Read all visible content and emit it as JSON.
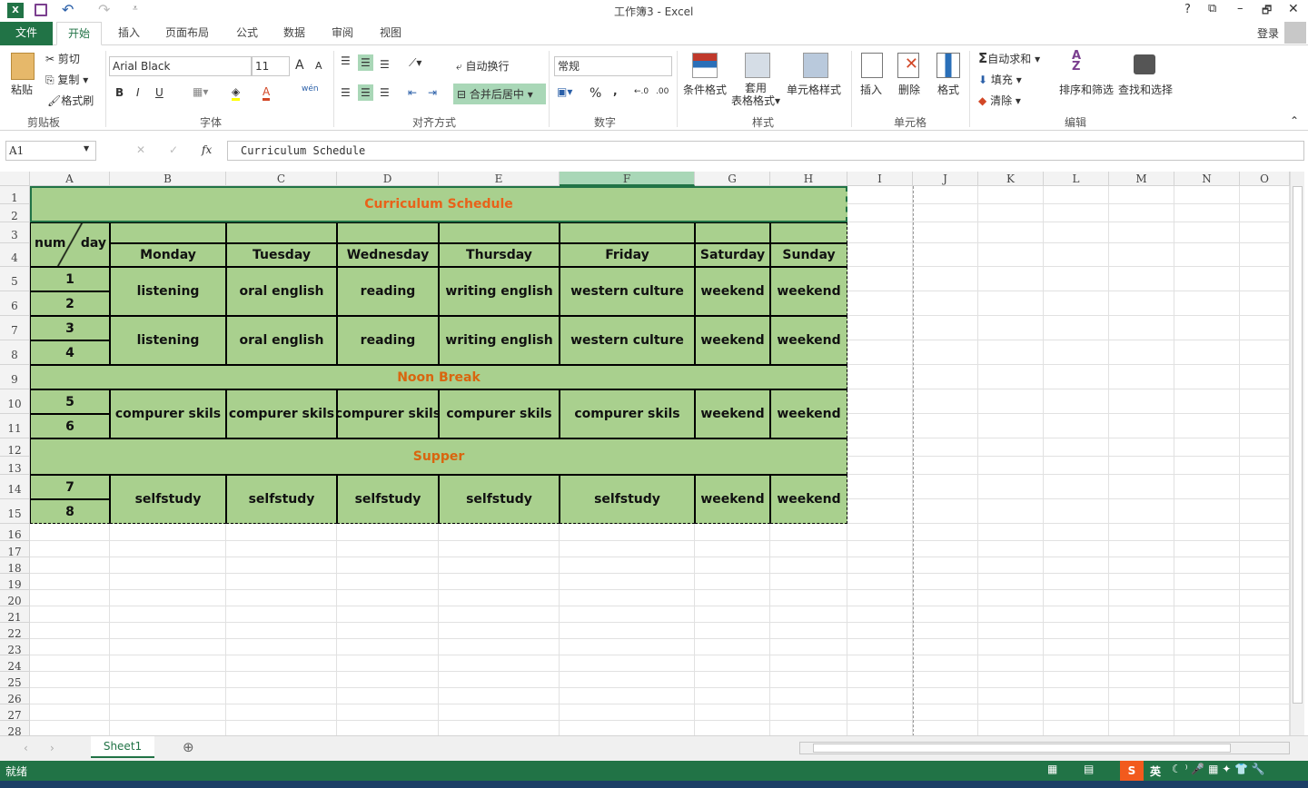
{
  "title_bar": {
    "title": "工作簿3 - Excel",
    "help": "?",
    "ribbon_display": "⧉",
    "minimize": "–",
    "restore": "🗗",
    "close": "✕",
    "login": "登录"
  },
  "tabs": [
    "文件",
    "开始",
    "插入",
    "页面布局",
    "公式",
    "数据",
    "审阅",
    "视图"
  ],
  "active_tab": "开始",
  "ribbon": {
    "clipboard": {
      "paste": "粘贴",
      "cut": "剪切",
      "copy": "复制",
      "format_painter": "格式刷",
      "label": "剪贴板"
    },
    "font": {
      "name": "Arial Black",
      "size": "11",
      "bold": "B",
      "italic": "I",
      "underline": "U",
      "grow": "A",
      "shrink": "A",
      "font_color": "A",
      "phonetic": "wén",
      "label": "字体"
    },
    "alignment": {
      "wrap": "自动换行",
      "merge": "合并后居中",
      "label": "对齐方式"
    },
    "number": {
      "format": "常规",
      "percent": "%",
      "comma": ",",
      "inc_dec": "←.0",
      "dec_dec": ".00",
      "label": "数字"
    },
    "styles": {
      "conditional": "条件格式",
      "table_format_1": "套用",
      "table_format_2": "表格格式",
      "cell_styles": "单元格样式",
      "label": "样式"
    },
    "cells": {
      "insert": "插入",
      "delete": "删除",
      "format": "格式",
      "label": "单元格"
    },
    "editing": {
      "autosum": "自动求和",
      "fill": "填充",
      "clear": "清除",
      "sort": "排序和筛选",
      "find": "查找和选择",
      "label": "编辑"
    }
  },
  "formula_bar": {
    "name_box": "A1",
    "cancel": "✕",
    "enter": "✓",
    "fx": "fx",
    "content": "Curriculum Schedule"
  },
  "columns": [
    "A",
    "B",
    "C",
    "D",
    "E",
    "F",
    "G",
    "H",
    "I",
    "J",
    "K",
    "L",
    "M",
    "N",
    "O"
  ],
  "selected_column": "F",
  "rows": [
    1,
    2,
    3,
    4,
    5,
    6,
    7,
    8,
    9,
    10,
    11,
    12,
    13,
    14,
    15,
    16,
    17,
    18,
    19,
    20,
    21,
    22,
    23,
    24,
    25,
    26,
    27,
    28
  ],
  "fill_color": "#a9d08e",
  "title_color": "#e8621a",
  "cells": [
    {
      "range": "A1:H2",
      "text": "Curriculum Schedule",
      "style": "title"
    },
    {
      "range": "A3:A4",
      "text": "",
      "style": "diag",
      "diag_left": "num",
      "diag_right": "day"
    },
    {
      "range": "B3",
      "text": ""
    },
    {
      "range": "C3",
      "text": ""
    },
    {
      "range": "D3",
      "text": ""
    },
    {
      "range": "E3",
      "text": ""
    },
    {
      "range": "F3",
      "text": ""
    },
    {
      "range": "G3",
      "text": ""
    },
    {
      "range": "H3",
      "text": ""
    },
    {
      "range": "B4",
      "text": "Monday"
    },
    {
      "range": "C4",
      "text": "Tuesday"
    },
    {
      "range": "D4",
      "text": "Wednesday"
    },
    {
      "range": "E4",
      "text": "Thursday"
    },
    {
      "range": "F4",
      "text": "Friday"
    },
    {
      "range": "G4",
      "text": "Saturday"
    },
    {
      "range": "H4",
      "text": "Sunday"
    },
    {
      "range": "A5",
      "text": "1"
    },
    {
      "range": "A6",
      "text": "2"
    },
    {
      "range": "B5:B6",
      "text": "listening"
    },
    {
      "range": "C5:C6",
      "text": "oral english"
    },
    {
      "range": "D5:D6",
      "text": "reading"
    },
    {
      "range": "E5:E6",
      "text": "writing english"
    },
    {
      "range": "F5:F6",
      "text": "western culture"
    },
    {
      "range": "G5:G6",
      "text": "weekend"
    },
    {
      "range": "H5:H6",
      "text": "weekend"
    },
    {
      "range": "A7",
      "text": "3"
    },
    {
      "range": "A8",
      "text": "4"
    },
    {
      "range": "B7:B8",
      "text": "listening"
    },
    {
      "range": "C7:C8",
      "text": "oral english"
    },
    {
      "range": "D7:D8",
      "text": "reading"
    },
    {
      "range": "E7:E8",
      "text": "writing english"
    },
    {
      "range": "F7:F8",
      "text": "western culture"
    },
    {
      "range": "G7:G8",
      "text": "weekend"
    },
    {
      "range": "H7:H8",
      "text": "weekend"
    },
    {
      "range": "A9:H9",
      "text": "Noon Break",
      "style": "band"
    },
    {
      "range": "A10",
      "text": "5"
    },
    {
      "range": "A11",
      "text": "6"
    },
    {
      "range": "B10:B11",
      "text": "compurer skils"
    },
    {
      "range": "C10:C11",
      "text": "compurer skils"
    },
    {
      "range": "D10:D11",
      "text": "compurer skils"
    },
    {
      "range": "E10:E11",
      "text": "compurer skils"
    },
    {
      "range": "F10:F11",
      "text": "compurer skils"
    },
    {
      "range": "G10:G11",
      "text": "weekend"
    },
    {
      "range": "H10:H11",
      "text": "weekend"
    },
    {
      "range": "A12:H13",
      "text": "Supper",
      "style": "band"
    },
    {
      "range": "A14",
      "text": "7"
    },
    {
      "range": "A15",
      "text": "8"
    },
    {
      "range": "B14:B15",
      "text": "selfstudy"
    },
    {
      "range": "C14:C15",
      "text": "selfstudy"
    },
    {
      "range": "D14:D15",
      "text": "selfstudy"
    },
    {
      "range": "E14:E15",
      "text": "selfstudy"
    },
    {
      "range": "F14:F15",
      "text": "selfstudy"
    },
    {
      "range": "G14:G15",
      "text": "weekend"
    },
    {
      "range": "H14:H15",
      "text": "weekend"
    }
  ],
  "sheets": [
    "Sheet1"
  ],
  "add_sheet": "⊕",
  "status": {
    "ready": "就绪",
    "ime": "英"
  }
}
